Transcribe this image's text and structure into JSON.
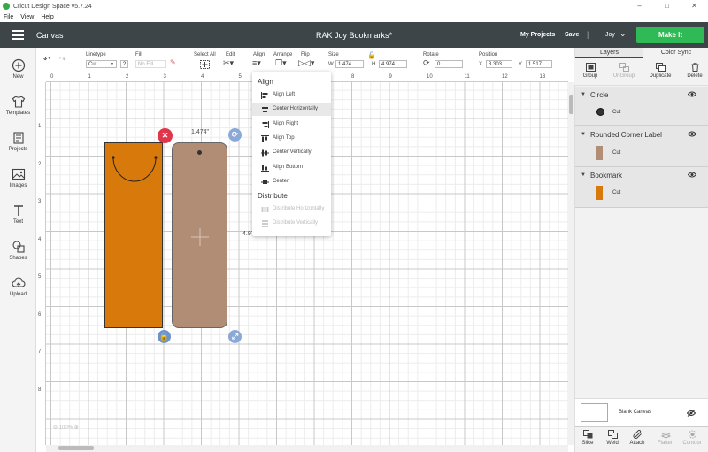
{
  "window": {
    "title": "Cricut Design Space  v5.7.24"
  },
  "menubar": {
    "file": "File",
    "view": "View",
    "help": "Help"
  },
  "header": {
    "section": "Canvas",
    "project_title": "RAK Joy Bookmarks*",
    "my_projects": "My Projects",
    "save": "Save",
    "separator": "|",
    "user": "Joy",
    "make_it": "Make It",
    "make_it_color": "#2fba55"
  },
  "leftnav": {
    "items": [
      "New",
      "Templates",
      "Projects",
      "Images",
      "Text",
      "Shapes",
      "Upload"
    ]
  },
  "toolbar": {
    "linetype_label": "Linetype",
    "linetype_value": "Cut",
    "fill_label": "Fill",
    "fill_value": "No Fill",
    "help_q": "?",
    "select_all": "Select All",
    "edit": "Edit",
    "align": "Align",
    "arrange": "Arrange",
    "flip": "Flip",
    "size": "Size",
    "w_label": "W",
    "w_value": "1.474",
    "h_label": "H",
    "h_value": "4.974",
    "rotate": "Rotate",
    "rotate_value": "0",
    "position": "Position",
    "x_label": "X",
    "x_value": "3.303",
    "y_label": "Y",
    "y_value": "1.517"
  },
  "ruler": {
    "top": [
      "0",
      "1",
      "2",
      "3",
      "4",
      "5",
      "6",
      "7",
      "8",
      "9",
      "10",
      "11",
      "12",
      "13"
    ],
    "left": [
      "1",
      "2",
      "3",
      "4",
      "5",
      "6",
      "7",
      "8"
    ]
  },
  "canvas": {
    "dim_width": "1.474\"",
    "dim_height": "4.97",
    "zoom": "100%",
    "bookmark_color": "#d7790b",
    "label_color": "#b08d74"
  },
  "align_menu": {
    "align_header": "Align",
    "items": [
      "Align Left",
      "Center Horizontally",
      "Align Right",
      "Align Top",
      "Center Vertically",
      "Align Bottom",
      "Center"
    ],
    "distribute_header": "Distribute",
    "distribute_items": [
      "Distribute Horizontally",
      "Distribute Vertically"
    ]
  },
  "right_panel": {
    "tabs": [
      "Layers",
      "Color Sync"
    ],
    "actions": [
      "Group",
      "UnGroup",
      "Duplicate",
      "Delete"
    ],
    "layers": [
      {
        "name": "Circle",
        "op": "Cut",
        "color": "#333333"
      },
      {
        "name": "Rounded Corner Label",
        "op": "Cut",
        "color": "#b08d74"
      },
      {
        "name": "Bookmark",
        "op": "Cut",
        "color": "#d7790b"
      }
    ],
    "blank_canvas": "Blank Canvas",
    "bottom_tools": [
      "Slice",
      "Weld",
      "Attach",
      "Flatten",
      "Contour"
    ]
  }
}
